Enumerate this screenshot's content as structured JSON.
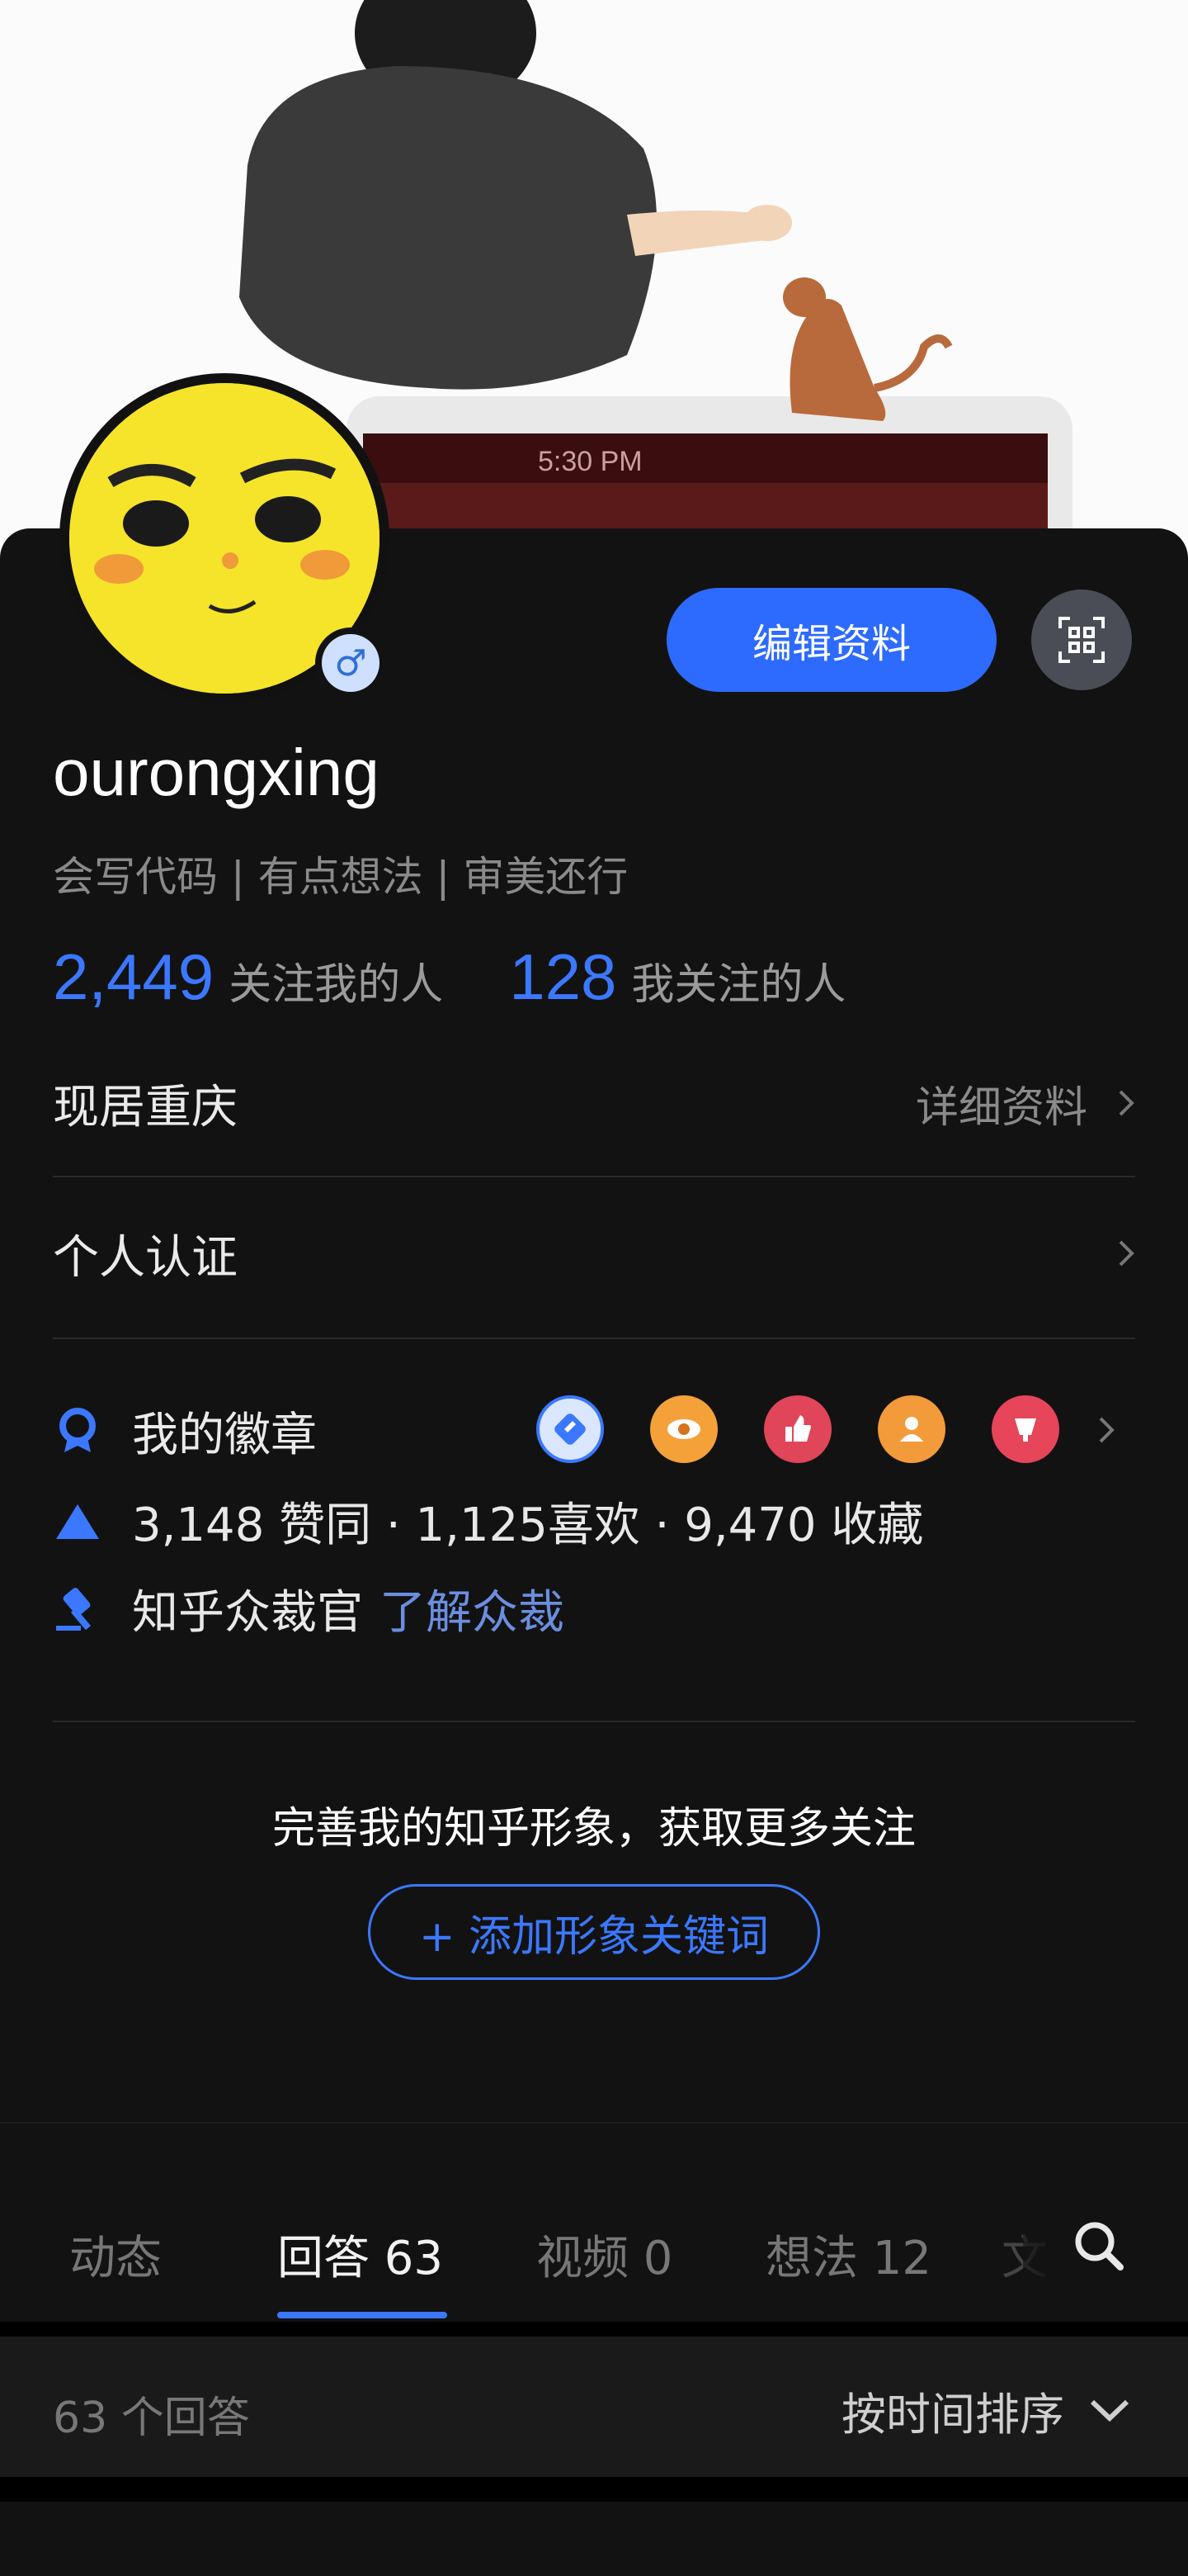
{
  "cover": {
    "status_time": "5:30 PM"
  },
  "profile": {
    "username": "ourongxing",
    "bio": "会写代码 | 有点想法 | 审美还行",
    "edit_label": "编辑资料",
    "followers_count": "2,449",
    "followers_label": "关注我的人",
    "following_count": "128",
    "following_label": "我关注的人"
  },
  "info": {
    "location": "现居重庆",
    "details_link": "详细资料",
    "certification": "个人认证"
  },
  "badges": {
    "label": "我的徽章",
    "items": [
      "edit-badge-icon",
      "eye-badge-icon",
      "like-badge-icon",
      "person-badge-icon",
      "cup-badge-icon"
    ]
  },
  "achievements": {
    "text": "3,148 赞同 · 1,125喜欢 · 9,470 收藏"
  },
  "moderator": {
    "label": "知乎众裁官",
    "link": "了解众裁"
  },
  "promo": {
    "text": "完善我的知乎形象，获取更多关注",
    "button": "+ 添加形象关键词"
  },
  "tabs": [
    {
      "label": "动态"
    },
    {
      "label": "回答 63"
    },
    {
      "label": "视频 0"
    },
    {
      "label": "想法 12"
    },
    {
      "label": "文"
    }
  ],
  "answers": {
    "count_text": "63 个回答",
    "sort_label": "按时间排序"
  },
  "colors": {
    "accent": "#3b78ff",
    "background": "#121212"
  }
}
